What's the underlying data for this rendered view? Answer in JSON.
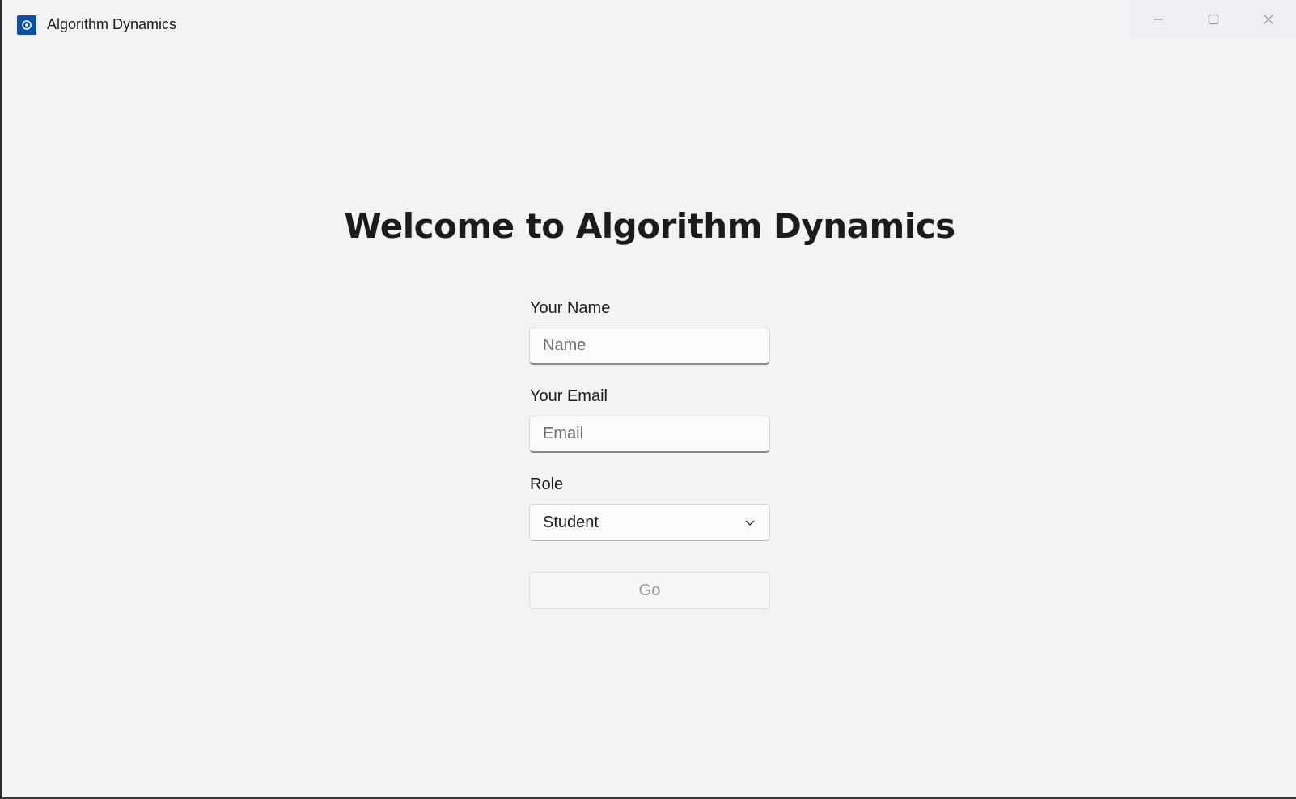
{
  "window": {
    "title": "Algorithm Dynamics"
  },
  "page": {
    "welcome": "Welcome to Algorithm Dynamics"
  },
  "form": {
    "name_label": "Your Name",
    "name_placeholder": "Name",
    "name_value": "",
    "email_label": "Your Email",
    "email_placeholder": "Email",
    "email_value": "",
    "role_label": "Role",
    "role_selected": "Student",
    "go_label": "Go",
    "go_enabled": false
  },
  "icons": {
    "app": "app-icon",
    "minimize": "minimize-icon",
    "maximize": "maximize-icon",
    "close": "close-icon",
    "dropdown": "chevron-down-icon"
  },
  "colors": {
    "accent": "#0b4fa8",
    "background": "#f3f3f3",
    "text": "#1b1b1b",
    "disabled_text": "#9c9c9c"
  }
}
